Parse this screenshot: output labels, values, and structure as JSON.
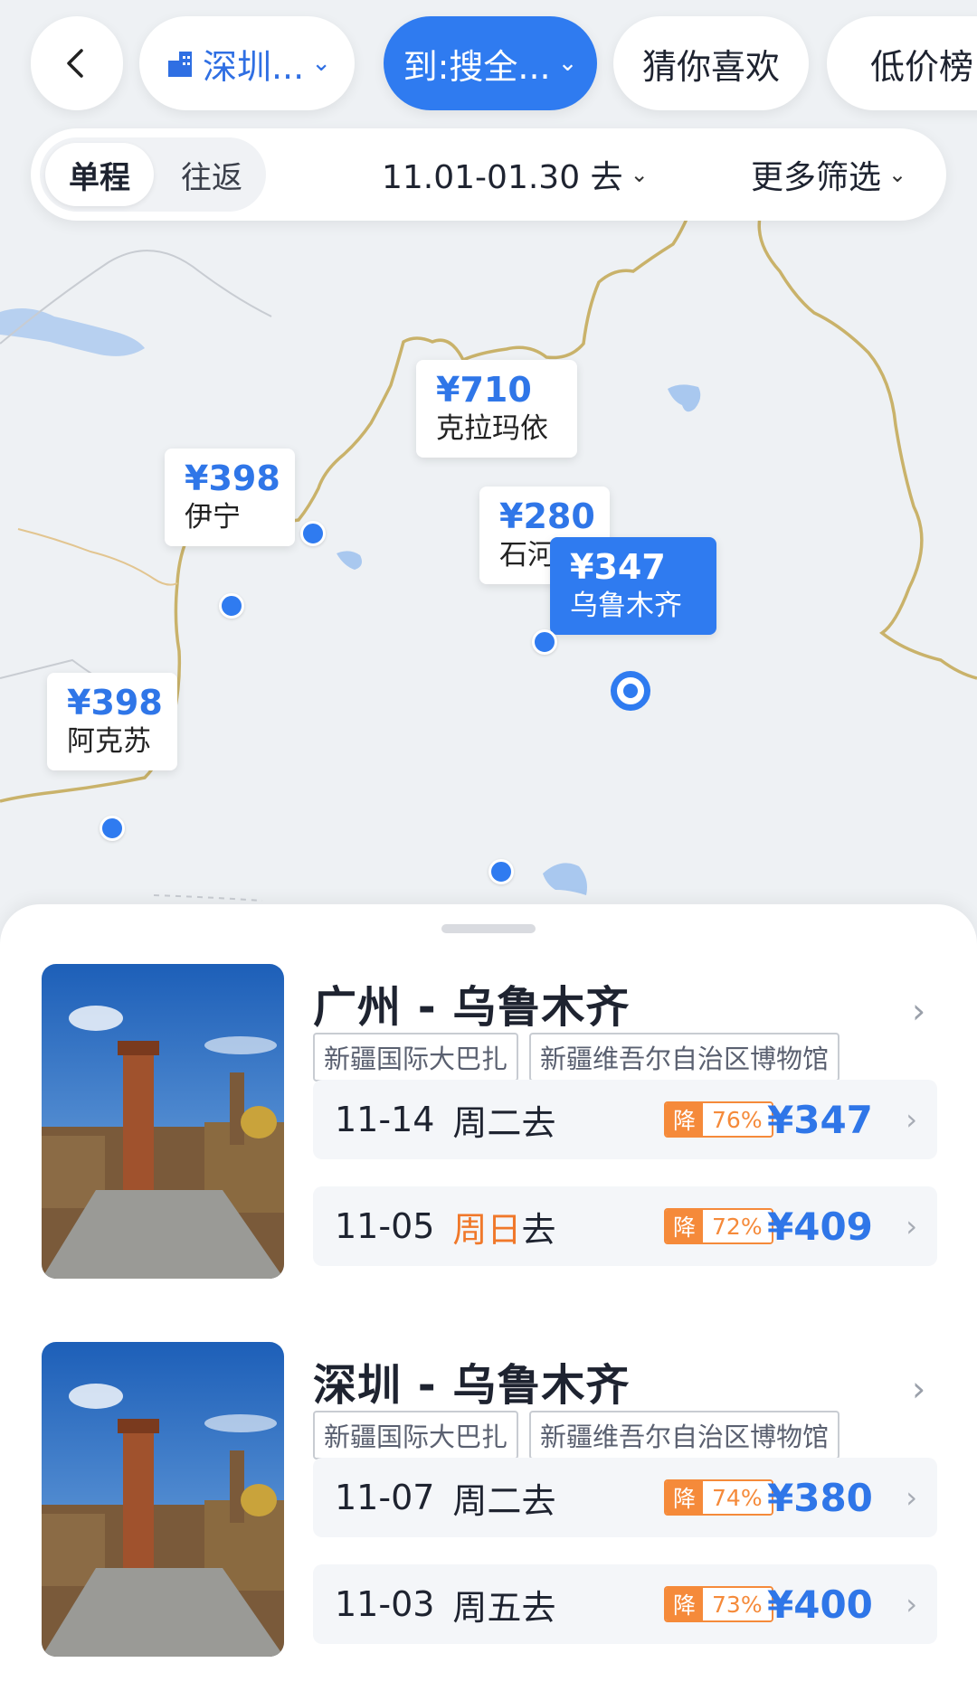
{
  "nav": {
    "back_icon": "chevron-left",
    "from_icon": "building",
    "from_label": "深圳...",
    "to_label": "到:搜全...",
    "guess_label": "猜你喜欢",
    "lowprice_label": "低价榜"
  },
  "filter": {
    "one_way": "单程",
    "round_trip": "往返",
    "date_range": "11.01-01.30 去",
    "more": "更多筛选"
  },
  "map": {
    "pins": [
      {
        "price": "¥710",
        "city": "克拉玛依"
      },
      {
        "price": "¥398",
        "city": "伊宁"
      },
      {
        "price": "¥280",
        "city": "石河"
      },
      {
        "price": "¥347",
        "city": "乌鲁木齐",
        "selected": true
      },
      {
        "price": "¥398",
        "city": "阿克苏"
      }
    ],
    "colors": {
      "accent": "#2f7bf0",
      "border": "#c9b26a",
      "water": "#a9c8ef"
    }
  },
  "routes": [
    {
      "title": "广州 - 乌鲁木齐",
      "tags": [
        "新疆国际大巴扎",
        "新疆维吾尔自治区博物馆"
      ],
      "fares": [
        {
          "date": "11-14",
          "weekday": "周二",
          "suffix": "去",
          "badge_label": "降",
          "discount": "76%",
          "price": "¥347"
        },
        {
          "date": "11-05",
          "weekday": "周日",
          "suffix": "去",
          "badge_label": "降",
          "discount": "72%",
          "price": "¥409",
          "weekend": true
        }
      ]
    },
    {
      "title": "深圳 - 乌鲁木齐",
      "tags": [
        "新疆国际大巴扎",
        "新疆维吾尔自治区博物馆"
      ],
      "fares": [
        {
          "date": "11-07",
          "weekday": "周二",
          "suffix": "去",
          "badge_label": "降",
          "discount": "74%",
          "price": "¥380"
        },
        {
          "date": "11-03",
          "weekday": "周五",
          "suffix": "去",
          "badge_label": "降",
          "discount": "73%",
          "price": "¥400"
        }
      ]
    }
  ]
}
